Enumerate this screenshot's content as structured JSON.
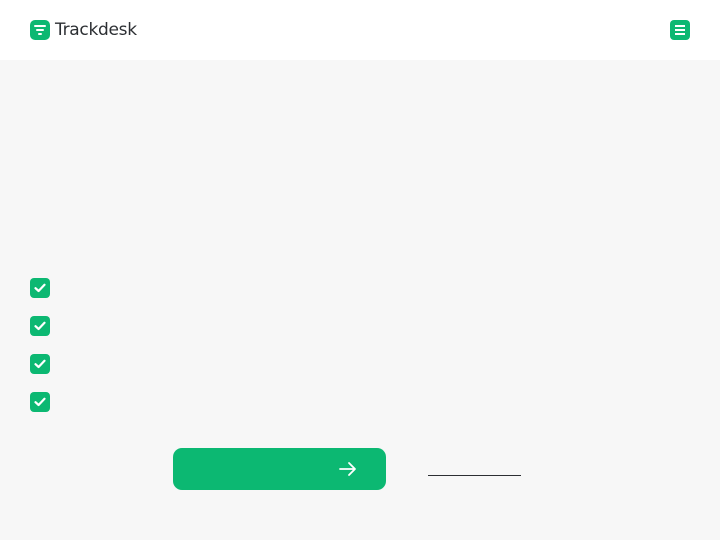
{
  "header": {
    "logo_text": "Trackdesk",
    "logo_icon": "trackdesk-logo-icon",
    "menu_icon": "hamburger-menu-icon"
  },
  "checklist": {
    "items": [
      {
        "icon": "checkbox-checked-icon",
        "label": ""
      },
      {
        "icon": "checkbox-checked-icon",
        "label": ""
      },
      {
        "icon": "checkbox-checked-icon",
        "label": ""
      },
      {
        "icon": "checkbox-checked-icon",
        "label": ""
      }
    ]
  },
  "cta": {
    "label": "",
    "icon": "arrow-right-icon"
  },
  "secondary_link": {
    "label": ""
  },
  "colors": {
    "accent": "#0cb872",
    "background": "#f7f7f7",
    "header_background": "#ffffff",
    "text": "#2c2f33"
  }
}
